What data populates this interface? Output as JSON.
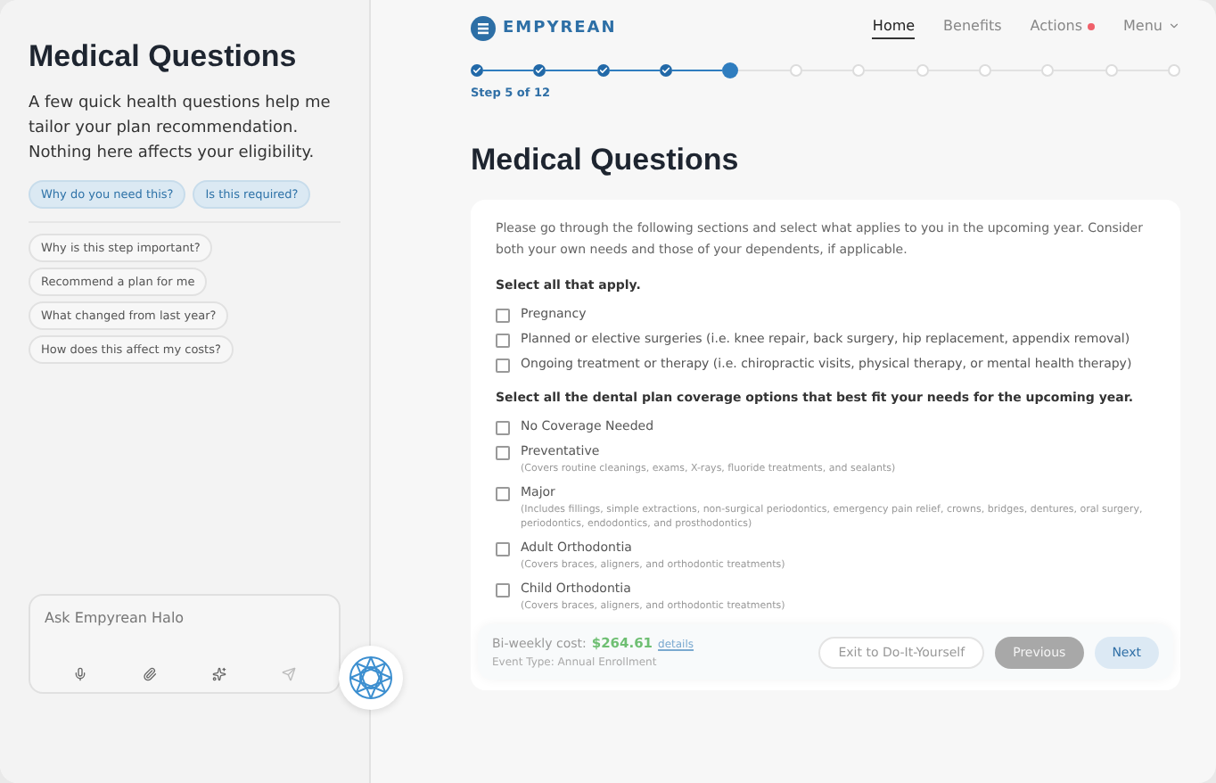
{
  "sidebar": {
    "title": "Medical Questions",
    "intro": "A few quick health questions help me tailor your plan recommendation. Nothing here affects your eligibility.",
    "primary_chips": [
      "Why do you need this?",
      "Is this required?"
    ],
    "suggestions": [
      "Why is this step important?",
      "Recommend a plan for me",
      "What changed from last year?",
      "How does this affect my costs?"
    ],
    "ask": {
      "placeholder": "Ask Empyrean Halo"
    }
  },
  "header": {
    "logo": "EMPYREAN",
    "nav": [
      {
        "label": "Home",
        "selected": true,
        "alert": false,
        "kind": "link"
      },
      {
        "label": "Benefits",
        "selected": false,
        "alert": false,
        "kind": "link"
      },
      {
        "label": "Actions",
        "selected": false,
        "alert": true,
        "kind": "link"
      },
      {
        "label": "Menu",
        "selected": false,
        "alert": false,
        "kind": "dropdown"
      }
    ]
  },
  "stepper": {
    "label": "Step 5 of 12",
    "steps": [
      {
        "completed": true,
        "selected": false
      },
      {
        "completed": true,
        "selected": false
      },
      {
        "completed": true,
        "selected": false
      },
      {
        "completed": true,
        "selected": false
      },
      {
        "completed": false,
        "selected": true
      },
      {
        "completed": false,
        "selected": false
      },
      {
        "completed": false,
        "selected": false
      },
      {
        "completed": false,
        "selected": false
      },
      {
        "completed": false,
        "selected": false
      },
      {
        "completed": false,
        "selected": false
      },
      {
        "completed": false,
        "selected": false
      },
      {
        "completed": false,
        "selected": false
      }
    ]
  },
  "page_title": "Medical Questions",
  "card": {
    "intro": "Please go through the following sections and select what applies to you in the upcoming year. Consider both your own needs and those of your dependents, if applicable.",
    "sections": [
      {
        "heading": "Select all that apply.",
        "options": [
          {
            "label": "Pregnancy",
            "checked": false
          },
          {
            "label": "Planned or elective surgeries (i.e. knee repair, back surgery, hip replacement, appendix removal)",
            "checked": false
          },
          {
            "label": "Ongoing treatment or therapy (i.e. chiropractic visits, physical therapy, or mental health therapy)",
            "checked": false
          }
        ]
      },
      {
        "heading": "Select all the dental plan coverage options that best fit your needs for the upcoming year.",
        "options": [
          {
            "label": "No Coverage Needed",
            "checked": false
          },
          {
            "label": "Preventative",
            "note": "(Covers routine cleanings, exams, X-rays, fluoride treatments, and sealants)",
            "checked": false
          },
          {
            "label": "Major",
            "note": "(Includes fillings, simple extractions, non-surgical periodontics, emergency pain relief, crowns, bridges, dentures, oral surgery, periodontics, endodontics, and prosthodontics)",
            "checked": false
          },
          {
            "label": "Adult Orthodontia",
            "note": "(Covers braces, aligners, and orthodontic treatments)",
            "checked": false
          },
          {
            "label": "Child Orthodontia",
            "note": "(Covers braces, aligners, and orthodontic treatments)",
            "checked": false
          }
        ]
      }
    ]
  },
  "footer": {
    "cost_label": "Bi-weekly cost:",
    "cost_value": "$264.61",
    "details_link": "details",
    "event_type": "Event Type: Annual Enrollment",
    "buttons": [
      {
        "label": "Exit to Do-It-Yourself",
        "kind": "outline",
        "disabled": false
      },
      {
        "label": "Previous",
        "kind": "secondary",
        "disabled": true
      },
      {
        "label": "Next",
        "kind": "primary",
        "disabled": true
      }
    ]
  }
}
